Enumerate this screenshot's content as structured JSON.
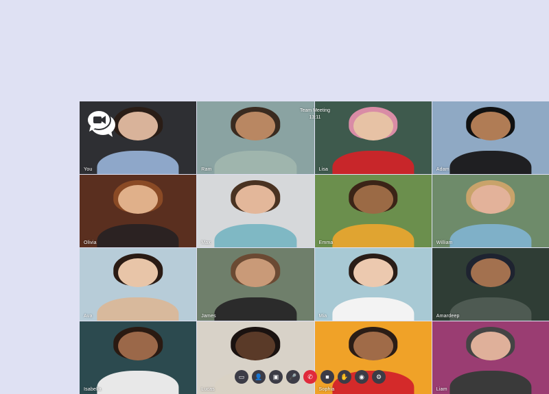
{
  "meeting": {
    "title": "Team Meeting",
    "time": "13:11"
  },
  "participants": [
    {
      "name": "You",
      "bg": "#2e2f33",
      "skin": "#d9b39a",
      "shirt": "#8ea7c9",
      "hair": "#2a1d16"
    },
    {
      "name": "Ram",
      "bg": "#8aa3a2",
      "skin": "#b98762",
      "shirt": "#9fb5ad",
      "hair": "#3a2b20"
    },
    {
      "name": "Lisa",
      "bg": "#3e5a4d",
      "skin": "#e7c2a5",
      "shirt": "#c8262a",
      "hair": "#d98ca6"
    },
    {
      "name": "Adam",
      "bg": "#8fa9c4",
      "skin": "#b07c55",
      "shirt": "#1f1f22",
      "hair": "#111111"
    },
    {
      "name": "Olivia",
      "bg": "#5a2f1f",
      "skin": "#e0b08a",
      "shirt": "#2b2222",
      "hair": "#8a4a25"
    },
    {
      "name": "Max",
      "bg": "#d6d8da",
      "skin": "#e3b79a",
      "shirt": "#7fb8c4",
      "hair": "#4a3322"
    },
    {
      "name": "Emma",
      "bg": "#6b8f4d",
      "skin": "#9b6a45",
      "shirt": "#e0a431",
      "hair": "#3b2417"
    },
    {
      "name": "William",
      "bg": "#6e8b6a",
      "skin": "#e3b29a",
      "shirt": "#7fb0c8",
      "hair": "#c9a36a"
    },
    {
      "name": "Ava",
      "bg": "#b7ccd8",
      "skin": "#e8c5a8",
      "shirt": "#d8b99c",
      "hair": "#2a1b14"
    },
    {
      "name": "James",
      "bg": "#6f7f6b",
      "skin": "#c99a78",
      "shirt": "#2b2b2b",
      "hair": "#6b4a33"
    },
    {
      "name": "Mia",
      "bg": "#a8c9d4",
      "skin": "#ecc9af",
      "shirt": "#f3f3f3",
      "hair": "#2a1d17"
    },
    {
      "name": "Amardeep",
      "bg": "#2f3d35",
      "skin": "#a3714f",
      "shirt": "#4e5a52",
      "hair": "#1e2330"
    },
    {
      "name": "Isabella",
      "bg": "#2c4a4f",
      "skin": "#9b6849",
      "shirt": "#e8e8e8",
      "hair": "#2a1a12"
    },
    {
      "name": "Lucas",
      "bg": "#d8d2c8",
      "skin": "#5a3a28",
      "shirt": "#d9d2c5",
      "hair": "#1a1210"
    },
    {
      "name": "Sophia",
      "bg": "#f0a228",
      "skin": "#a06b48",
      "shirt": "#d42a2a",
      "hair": "#2b1d16"
    },
    {
      "name": "Liam",
      "bg": "#9a3d72",
      "skin": "#dfb09a",
      "shirt": "#3a3a3a",
      "hair": "#444444"
    }
  ],
  "controls": [
    {
      "name": "chat-icon",
      "glyph": "▭"
    },
    {
      "name": "add-person-icon",
      "glyph": "👤"
    },
    {
      "name": "share-screen-icon",
      "glyph": "▣"
    },
    {
      "name": "microphone-icon",
      "glyph": "🎤"
    },
    {
      "name": "hang-up-icon",
      "glyph": "✆"
    },
    {
      "name": "camera-icon",
      "glyph": "■"
    },
    {
      "name": "raise-hand-icon",
      "glyph": "✋"
    },
    {
      "name": "record-icon",
      "glyph": "◉"
    },
    {
      "name": "settings-icon",
      "glyph": "⚙"
    }
  ],
  "colors": {
    "background": "#dfe1f3",
    "control": "#3c3c46",
    "hangup": "#e02a3c"
  }
}
